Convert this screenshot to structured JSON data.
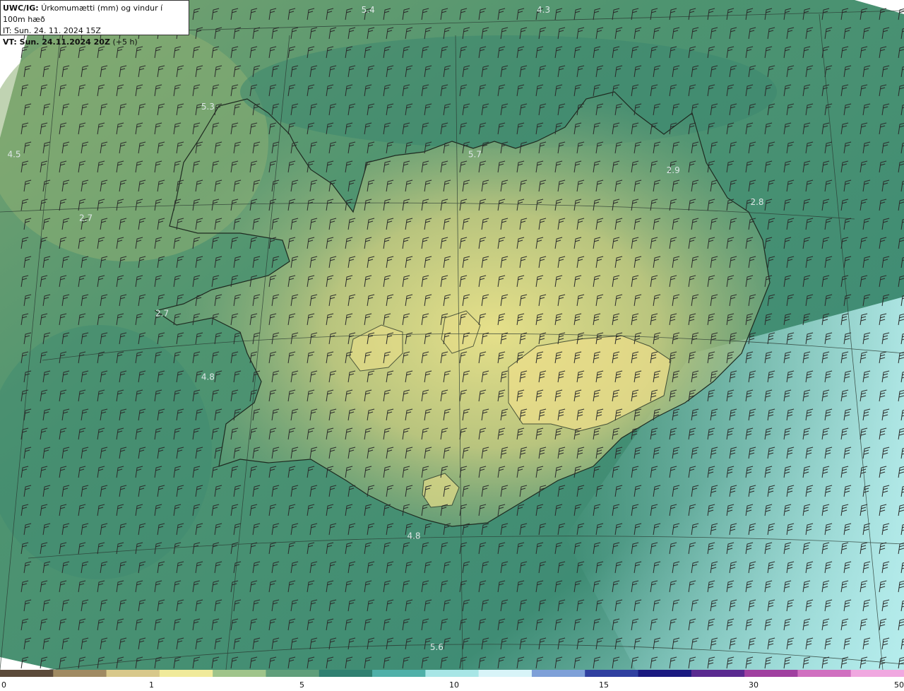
{
  "header": {
    "model": "UWC/IG:",
    "title": "Úrkomumætti (mm) og vindur í 100m hæð",
    "init_time": "IT: Sun. 24. 11. 2024 15Z",
    "valid_prefix": "VT: Sun. 24.11.2024 20Z",
    "valid_offset": "(+5 h)"
  },
  "map_labels": [
    {
      "text": "5.4",
      "lat": 67.75,
      "lon": -19.9
    },
    {
      "text": "4.3",
      "lat": 67.8,
      "lon": -17.6
    },
    {
      "text": "5.3",
      "lat": 66.3,
      "lon": -22.0
    },
    {
      "text": "4.5",
      "lat": 66.0,
      "lon": -25.6
    },
    {
      "text": "5.7",
      "lat": 66.0,
      "lon": -18.5
    },
    {
      "text": "2.9",
      "lat": 65.9,
      "lon": -15.9
    },
    {
      "text": "2.8",
      "lat": 65.7,
      "lon": -14.8
    },
    {
      "text": "2.7",
      "lat": 65.6,
      "lon": -23.6
    },
    {
      "text": "2.7",
      "lat": 65.0,
      "lon": -22.6
    },
    {
      "text": "4.8",
      "lat": 64.6,
      "lon": -22.0
    },
    {
      "text": "4.8",
      "lat": 63.6,
      "lon": -19.3
    },
    {
      "text": "5.6",
      "lat": 62.9,
      "lon": -19.0
    }
  ],
  "colorbar": {
    "ticks": [
      "0",
      "1",
      "5",
      "10",
      "15",
      "30",
      "50"
    ],
    "colors": [
      "#5c4b3a",
      "#a08a62",
      "#d8c88a",
      "#f0ea9a",
      "#9fc48a",
      "#5f9e7a",
      "#2f8070",
      "#4fb0a8",
      "#a8e6e6",
      "#d8f4f8",
      "#7ea0d8",
      "#3040a0",
      "#1a1a80",
      "#5a2a90",
      "#a040a0",
      "#d070c0",
      "#f0a8e0"
    ]
  }
}
